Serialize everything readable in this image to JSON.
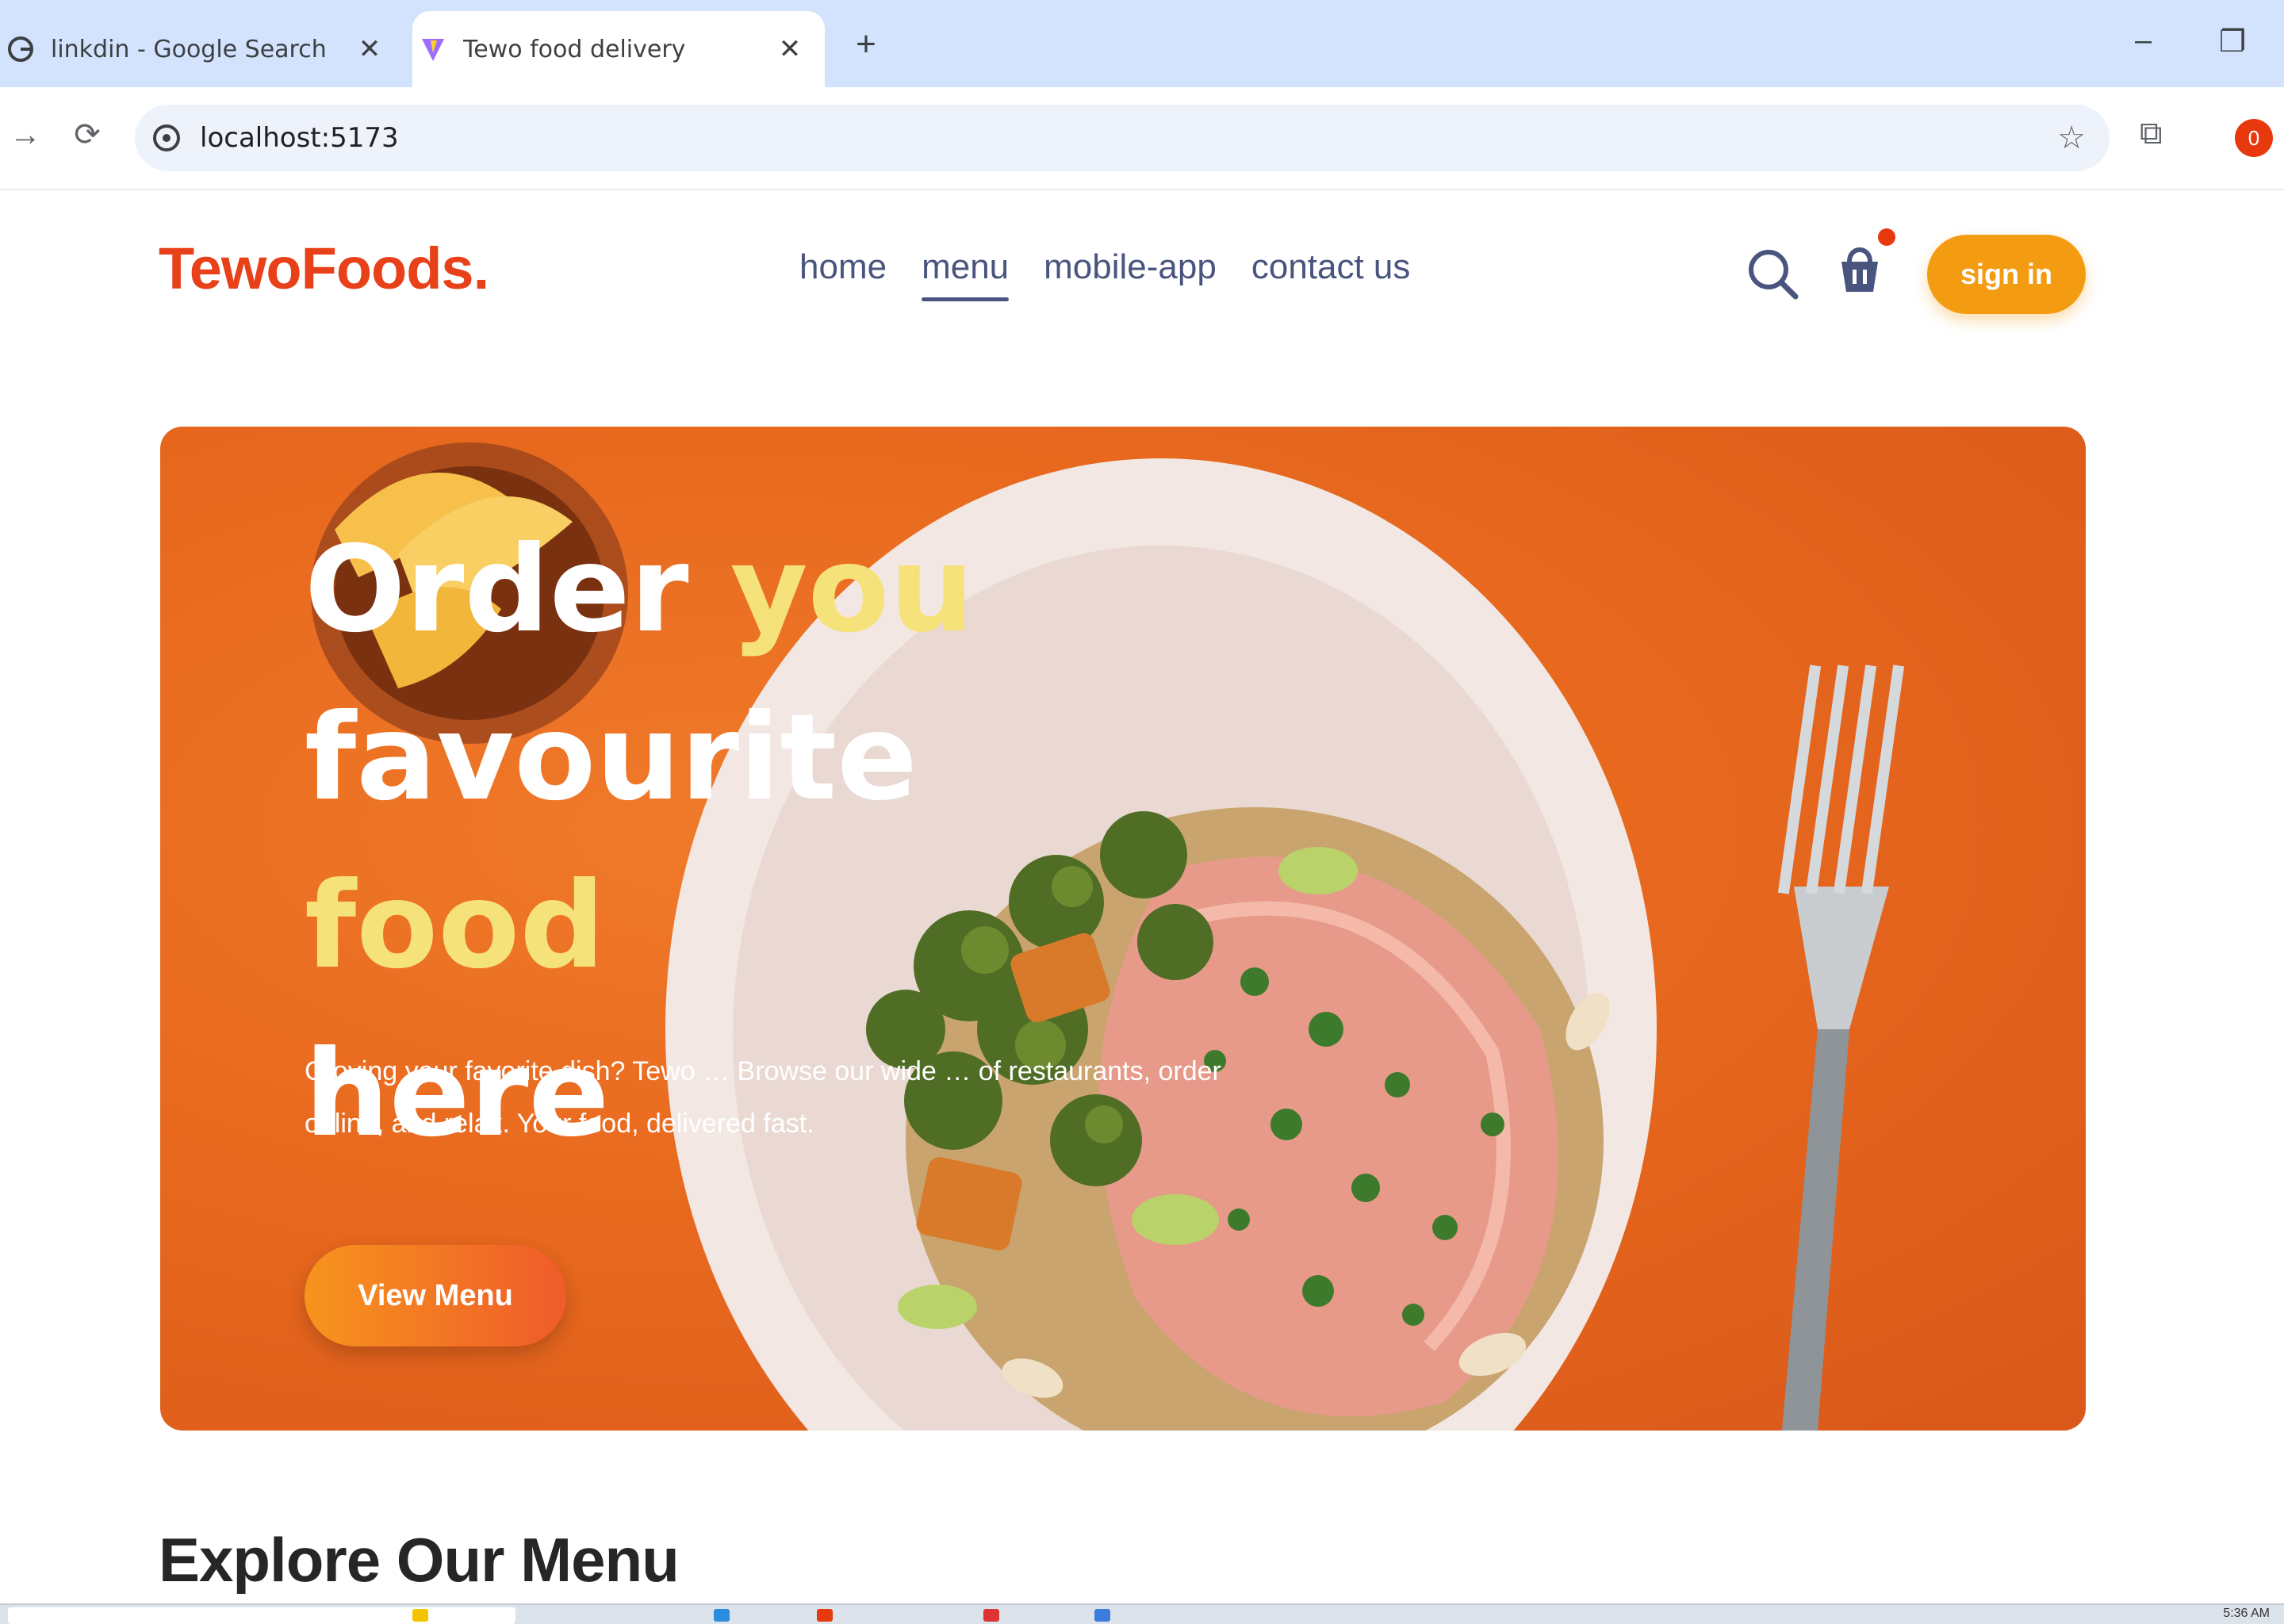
{
  "browser": {
    "tabs": [
      {
        "title": "linkdin - Google Search",
        "active": false,
        "icon": "google-icon"
      },
      {
        "title": "Tewo food delivery",
        "active": true,
        "icon": "vite-icon"
      }
    ],
    "new_tab_label": "+",
    "window_controls": {
      "minimize": "–",
      "restore": "❐"
    },
    "url": "localhost:5173",
    "profile_badge": "0"
  },
  "site": {
    "logo": "TewoFoods.",
    "nav": [
      {
        "label": "home",
        "active": false
      },
      {
        "label": "menu",
        "active": true
      },
      {
        "label": "mobile-app",
        "active": false
      },
      {
        "label": "contact us",
        "active": false
      }
    ],
    "sign_in_label": "sign in",
    "colors": {
      "brand": "#e8411a",
      "accent": "#f39c12",
      "nav_text": "#49557e",
      "hero_bg": "#e8691e"
    }
  },
  "hero": {
    "title_line1_white": "Order",
    "title_line1_highlight": "you",
    "title_line2_white": "favourite",
    "title_line2_highlight": "food",
    "title_line3": "here",
    "description": "Croving your favorite dish? Tewo … Browse our wide … of restaurants, order online, and relax. Your food, delivered fast.",
    "button_label": "View Menu"
  },
  "explore": {
    "title": "Explore Our Menu"
  },
  "taskbar": {
    "time": "5:36 AM"
  }
}
